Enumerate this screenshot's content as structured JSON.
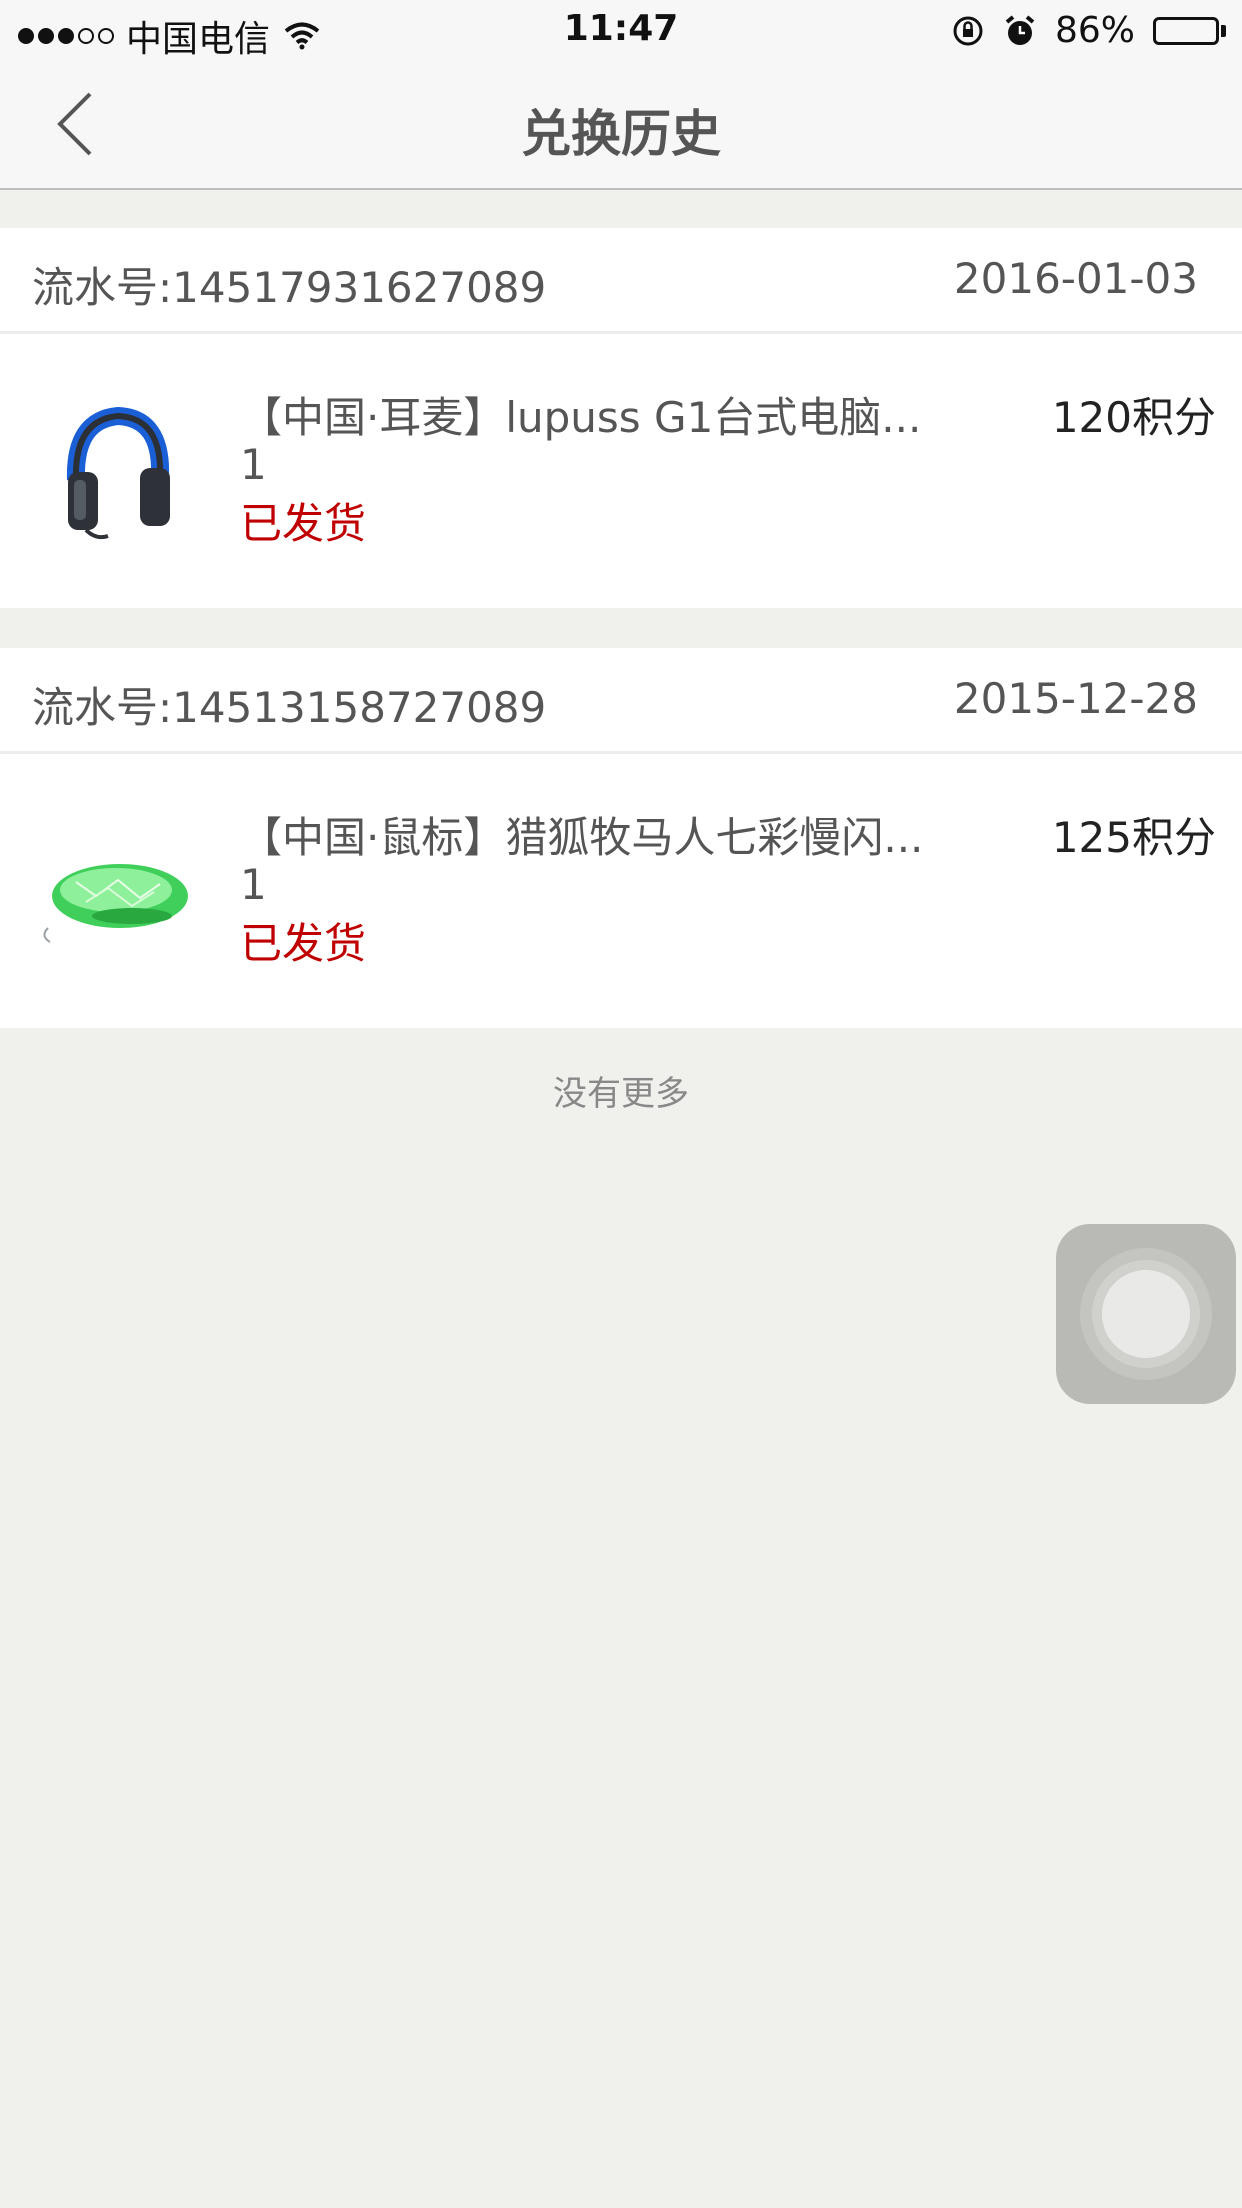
{
  "status_bar": {
    "carrier": "中国电信",
    "time": "11:47",
    "battery_percent": "86%",
    "battery_level": 0.86,
    "icons": [
      "signal-dots-icon",
      "wifi-icon",
      "orientation-lock-icon",
      "alarm-icon",
      "battery-icon"
    ]
  },
  "nav": {
    "title": "兑换历史",
    "back_icon": "chevron-left-icon"
  },
  "orders": [
    {
      "serial": "流水号:14517931627089",
      "date": "2016-01-03",
      "product_name": "【中国·耳麦】lupuss G1台式电脑...",
      "points": "120积分",
      "quantity": "1",
      "status": "已发货",
      "thumbnail": "headset-image"
    },
    {
      "serial": "流水号:14513158727089",
      "date": "2015-12-28",
      "product_name": "【中国·鼠标】猎狐牧马人七彩慢闪...",
      "points": "125积分",
      "quantity": "1",
      "status": "已发货",
      "thumbnail": "gaming-mouse-image"
    }
  ],
  "footer": {
    "no_more": "没有更多"
  },
  "colors": {
    "status_red": "#c00000",
    "background": "#f0f0ed",
    "card": "#ffffff"
  }
}
